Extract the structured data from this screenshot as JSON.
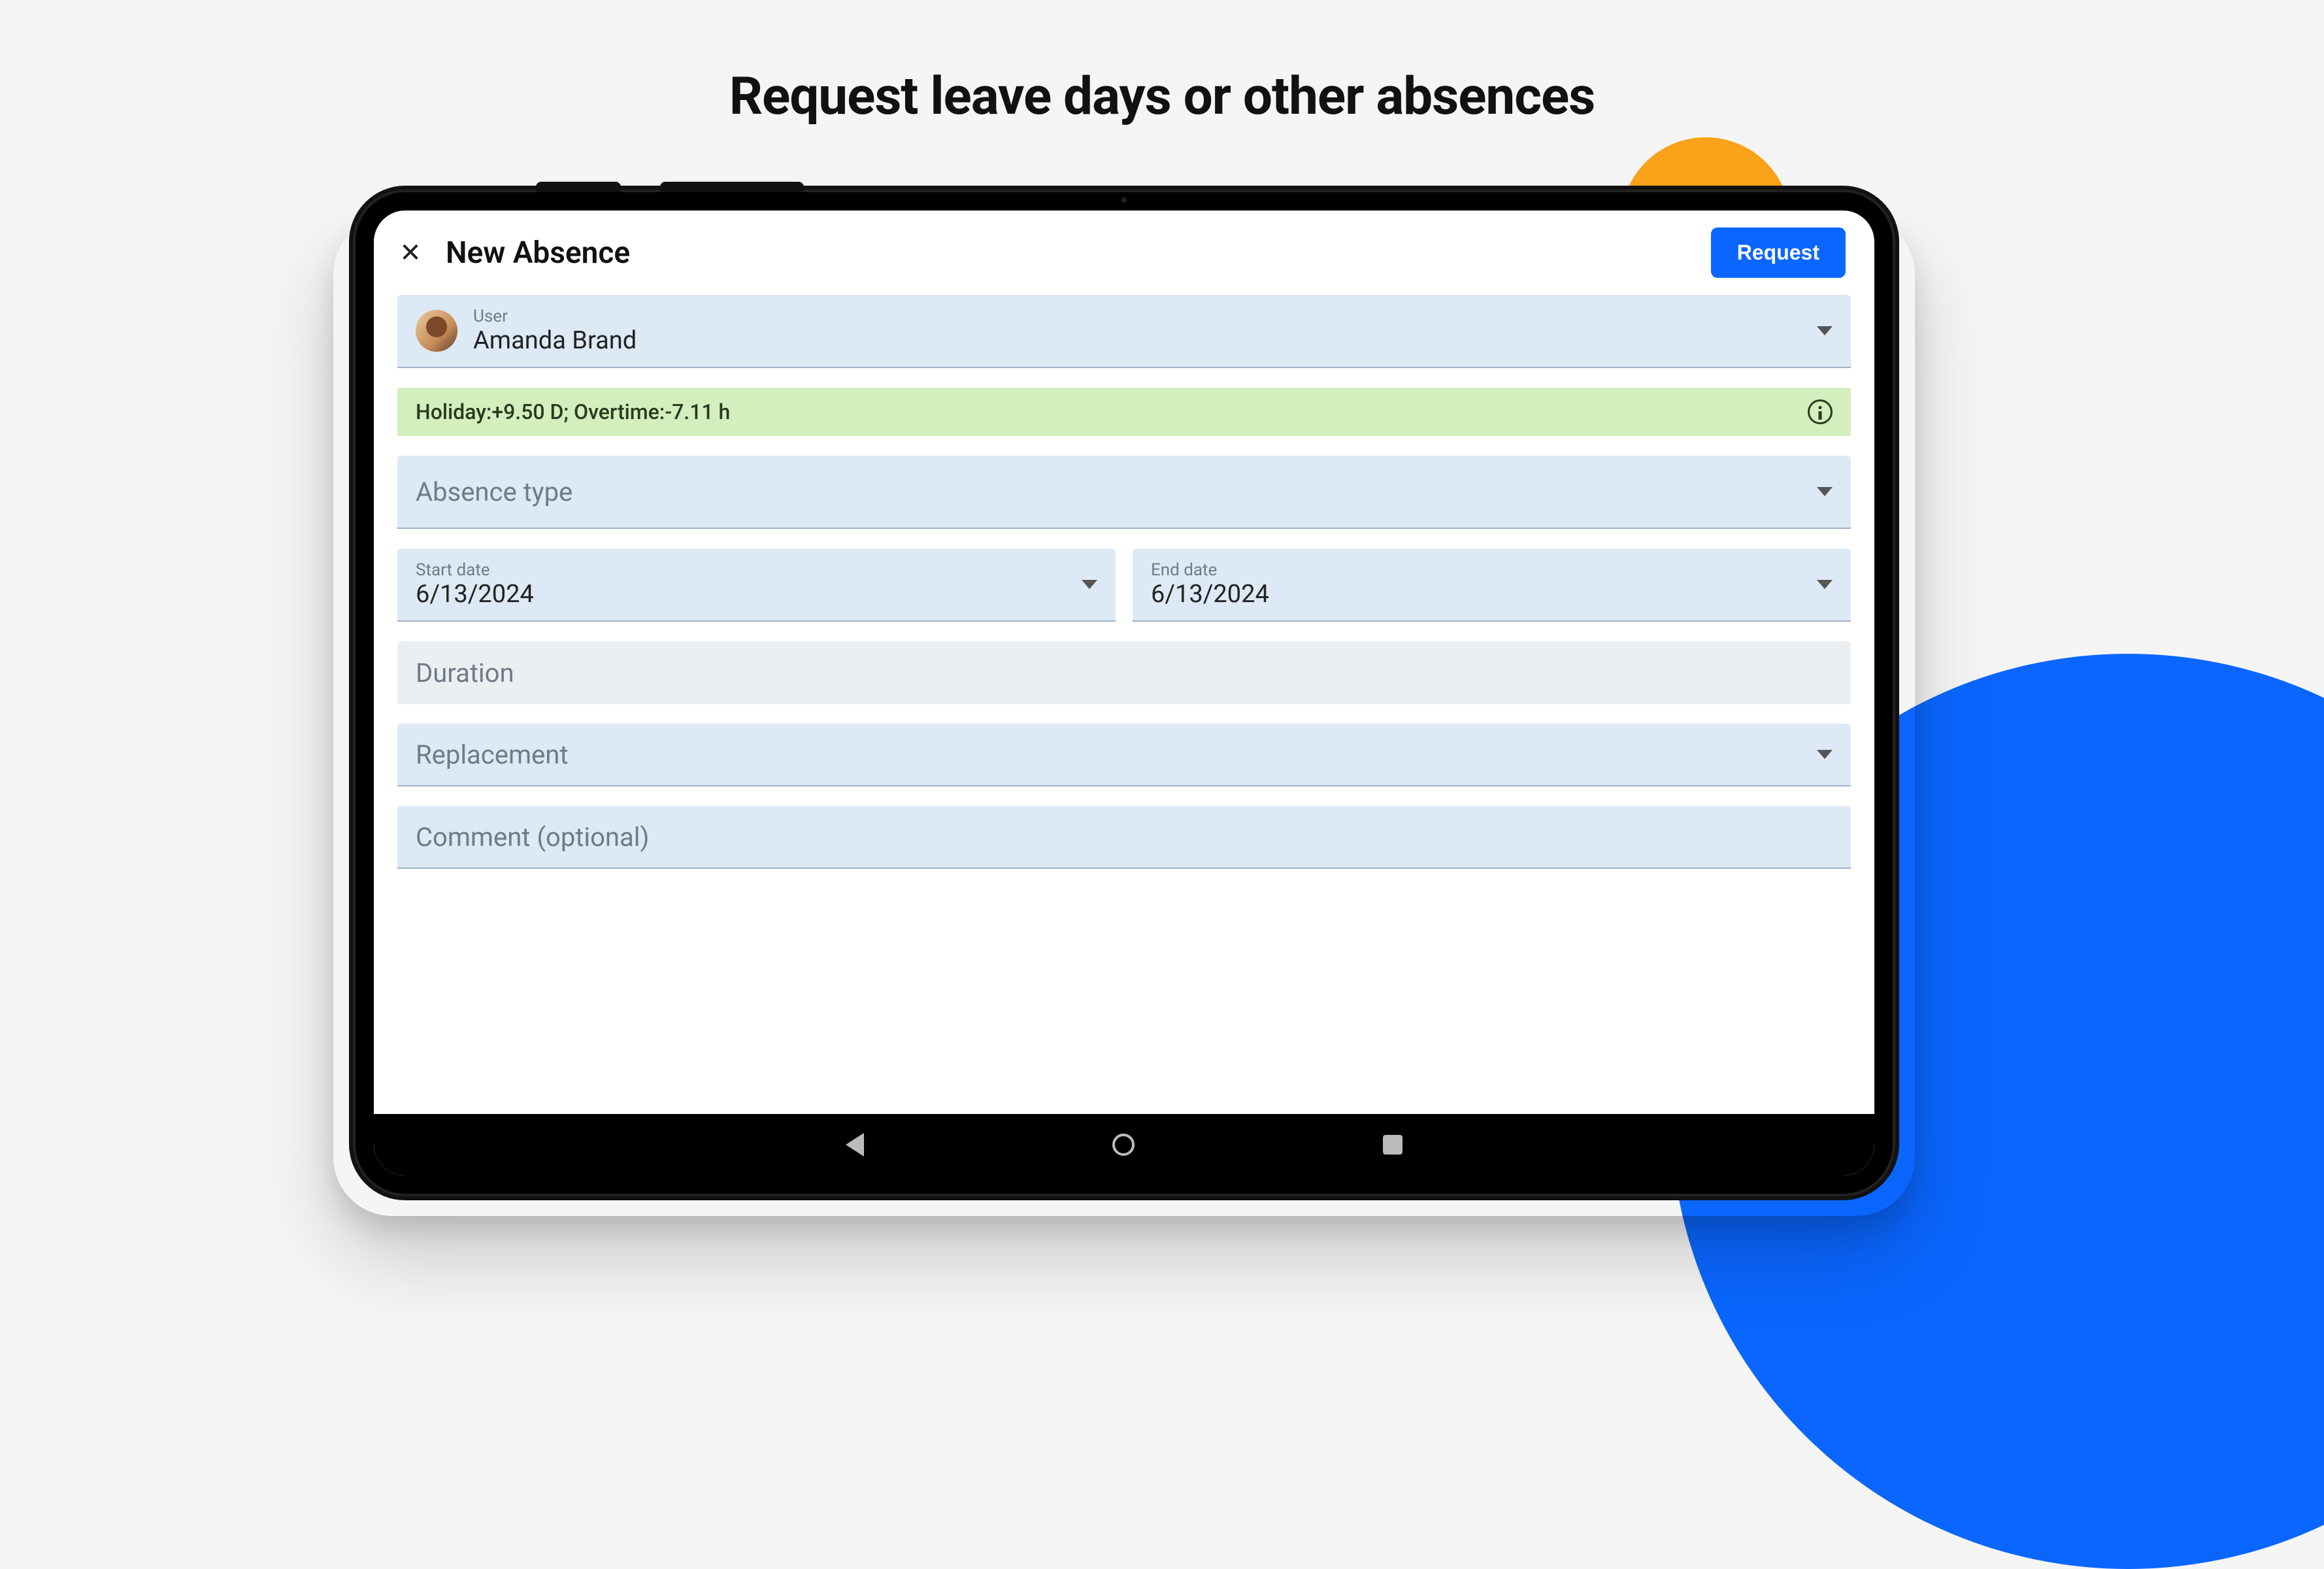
{
  "headline": "Request leave days or other absences",
  "header": {
    "title": "New Absence",
    "request_button": "Request"
  },
  "user_field": {
    "label": "User",
    "value": "Amanda Brand"
  },
  "balance_banner": "Holiday:+9.50 D; Overtime:-7.11 h",
  "absence_type": {
    "placeholder": "Absence type"
  },
  "start_date": {
    "label": "Start date",
    "value": "6/13/2024"
  },
  "end_date": {
    "label": "End date",
    "value": "6/13/2024"
  },
  "duration": {
    "placeholder": "Duration"
  },
  "replacement": {
    "placeholder": "Replacement"
  },
  "comment": {
    "placeholder": "Comment (optional)"
  },
  "colors": {
    "accent": "#0a66ff",
    "orange": "#f9a21a",
    "field_bg": "#dde9f5",
    "banner_bg": "#d3efbd"
  }
}
